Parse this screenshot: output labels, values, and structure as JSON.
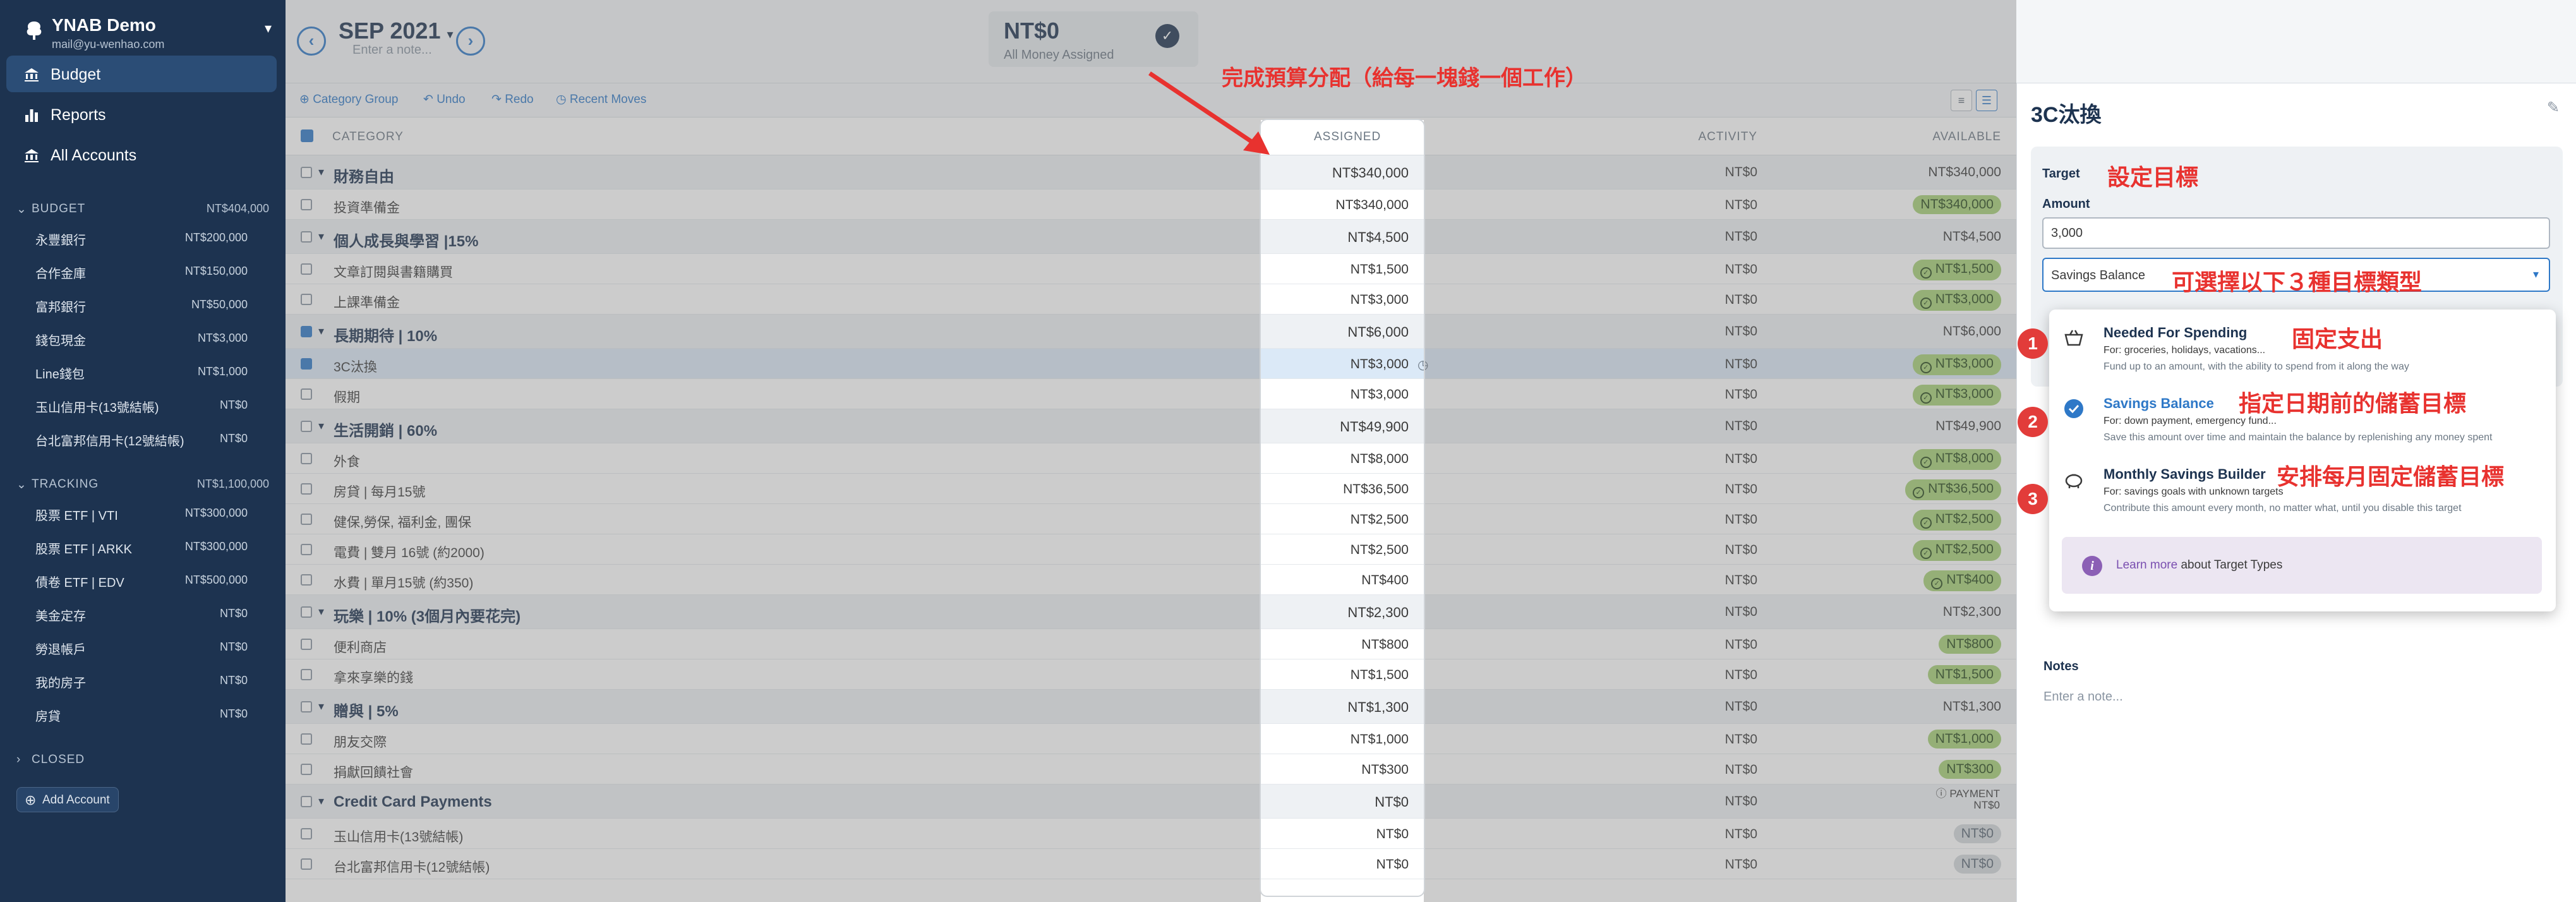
{
  "sidebar": {
    "budget_name": "YNAB Demo",
    "email": "mail@yu-wenhao.com",
    "nav": [
      {
        "label": "Budget",
        "icon": "bank-icon"
      },
      {
        "label": "Reports",
        "icon": "bar-chart-icon"
      },
      {
        "label": "All Accounts",
        "icon": "bank-icon"
      }
    ],
    "budget_section": {
      "title": "BUDGET",
      "amount": "NT$404,000"
    },
    "budget_accounts": [
      {
        "name": "永豐銀行",
        "value": "NT$200,000"
      },
      {
        "name": "合作金庫",
        "value": "NT$150,000"
      },
      {
        "name": "富邦銀行",
        "value": "NT$50,000"
      },
      {
        "name": "錢包現金",
        "value": "NT$3,000"
      },
      {
        "name": "Line錢包",
        "value": "NT$1,000"
      },
      {
        "name": "玉山信用卡(13號結帳)",
        "value": "NT$0"
      },
      {
        "name": "台北富邦信用卡(12號結帳)",
        "value": "NT$0"
      }
    ],
    "tracking_section": {
      "title": "TRACKING",
      "amount": "NT$1,100,000"
    },
    "tracking_accounts": [
      {
        "name": "股票 ETF | VTI",
        "value": "NT$300,000"
      },
      {
        "name": "股票 ETF | ARKK",
        "value": "NT$300,000"
      },
      {
        "name": "債卷 ETF | EDV",
        "value": "NT$500,000"
      },
      {
        "name": "美金定存",
        "value": "NT$0"
      },
      {
        "name": "勞退帳戶",
        "value": "NT$0"
      },
      {
        "name": "我的房子",
        "value": "NT$0"
      },
      {
        "name": "房貸",
        "value": "NT$0"
      }
    ],
    "closed_label": "CLOSED",
    "add_account": "Add Account"
  },
  "header": {
    "month": "SEP 2021",
    "month_caret": "▾",
    "note_placeholder": "Enter a note...",
    "prev": "‹",
    "next": "›",
    "tbb_value": "NT$0",
    "tbb_label": "All Money Assigned"
  },
  "toolbar": {
    "category_group": "Category Group",
    "undo": "Undo",
    "redo": "Redo",
    "recent_moves": "Recent Moves"
  },
  "columns": {
    "category": "CATEGORY",
    "assigned": "ASSIGNED",
    "activity": "ACTIVITY",
    "available": "AVAILABLE"
  },
  "rows": [
    {
      "type": "group",
      "name": "財務自由",
      "assigned": "NT$340,000",
      "activity": "NT$0",
      "available": "NT$340,000",
      "pill": "none"
    },
    {
      "type": "cat",
      "name": "投資準備金",
      "assigned": "NT$340,000",
      "activity": "NT$0",
      "available": "NT$340,000",
      "pill": "green"
    },
    {
      "type": "group",
      "name": "個人成長與學習 |15%",
      "assigned": "NT$4,500",
      "activity": "NT$0",
      "available": "NT$4,500",
      "pill": "none"
    },
    {
      "type": "cat",
      "name": "文章訂閱與書籍購買",
      "assigned": "NT$1,500",
      "activity": "NT$0",
      "available": "NT$1,500",
      "pill": "green-dot"
    },
    {
      "type": "cat",
      "name": "上課準備金",
      "assigned": "NT$3,000",
      "activity": "NT$0",
      "available": "NT$3,000",
      "pill": "green-dot"
    },
    {
      "type": "group",
      "name": "長期期待 | 10%",
      "assigned": "NT$6,000",
      "activity": "NT$0",
      "available": "NT$6,000",
      "pill": "none",
      "checked": true
    },
    {
      "type": "cat",
      "name": "3C汰換",
      "assigned": "NT$3,000",
      "activity": "NT$0",
      "available": "NT$3,000",
      "pill": "green-dot",
      "selected": true
    },
    {
      "type": "cat",
      "name": "假期",
      "assigned": "NT$3,000",
      "activity": "NT$0",
      "available": "NT$3,000",
      "pill": "green-dot"
    },
    {
      "type": "group",
      "name": "生活開銷 | 60%",
      "assigned": "NT$49,900",
      "activity": "NT$0",
      "available": "NT$49,900",
      "pill": "none"
    },
    {
      "type": "cat",
      "name": "外食",
      "assigned": "NT$8,000",
      "activity": "NT$0",
      "available": "NT$8,000",
      "pill": "green-dot"
    },
    {
      "type": "cat",
      "name": "房貸 | 每月15號",
      "assigned": "NT$36,500",
      "activity": "NT$0",
      "available": "NT$36,500",
      "pill": "green-dot"
    },
    {
      "type": "cat",
      "name": "健保,勞保, 福利金, 團保",
      "assigned": "NT$2,500",
      "activity": "NT$0",
      "available": "NT$2,500",
      "pill": "green-dot"
    },
    {
      "type": "cat",
      "name": "電費 | 雙月 16號 (約2000)",
      "assigned": "NT$2,500",
      "activity": "NT$0",
      "available": "NT$2,500",
      "pill": "green-dot"
    },
    {
      "type": "cat",
      "name": "水費 | 單月15號 (約350)",
      "assigned": "NT$400",
      "activity": "NT$0",
      "available": "NT$400",
      "pill": "green-dot"
    },
    {
      "type": "group",
      "name": "玩樂 | 10% (3個月內要花完)",
      "assigned": "NT$2,300",
      "activity": "NT$0",
      "available": "NT$2,300",
      "pill": "none"
    },
    {
      "type": "cat",
      "name": "便利商店",
      "assigned": "NT$800",
      "activity": "NT$0",
      "available": "NT$800",
      "pill": "green"
    },
    {
      "type": "cat",
      "name": "拿來享樂的錢",
      "assigned": "NT$1,500",
      "activity": "NT$0",
      "available": "NT$1,500",
      "pill": "green"
    },
    {
      "type": "group",
      "name": "贈與 | 5%",
      "assigned": "NT$1,300",
      "activity": "NT$0",
      "available": "NT$1,300",
      "pill": "none"
    },
    {
      "type": "cat",
      "name": "朋友交際",
      "assigned": "NT$1,000",
      "activity": "NT$0",
      "available": "NT$1,000",
      "pill": "green"
    },
    {
      "type": "cat",
      "name": "捐獻回饋社會",
      "assigned": "NT$300",
      "activity": "NT$0",
      "available": "NT$300",
      "pill": "green"
    },
    {
      "type": "group",
      "name": "Credit Card Payments",
      "assigned": "NT$0",
      "activity": "NT$0",
      "available": "NT$0",
      "pill": "payment",
      "payment_label": "PAYMENT"
    },
    {
      "type": "cat",
      "name": "玉山信用卡(13號結帳)",
      "assigned": "NT$0",
      "activity": "NT$0",
      "available": "NT$0",
      "pill": "gray"
    },
    {
      "type": "cat",
      "name": "台北富邦信用卡(12號結帳)",
      "assigned": "NT$0",
      "activity": "NT$0",
      "available": "NT$0",
      "pill": "gray"
    }
  ],
  "inspector": {
    "title": "3C汰換",
    "target_label": "Target",
    "amount_label": "Amount",
    "amount_value": "3,000",
    "select_value": "Savings Balance",
    "options": [
      {
        "title": "Needed For Spending",
        "for": "For: groceries, holidays, vacations...",
        "desc": "Fund up to an amount, with the ability to spend from it along the way",
        "icon": "basket-icon",
        "selected": false
      },
      {
        "title": "Savings Balance",
        "for": "For: down payment, emergency fund...",
        "desc": "Save this amount over time and maintain the balance by replenishing any money spent",
        "icon": "check-circle-icon",
        "selected": true
      },
      {
        "title": "Monthly Savings Builder",
        "for": "For: savings goals with unknown targets",
        "desc": "Contribute this amount every month, no matter what, until you disable this target",
        "icon": "piggy-bank-icon",
        "selected": false
      }
    ],
    "learn_link": "Learn more",
    "learn_rest": " about Target Types",
    "notes_label": "Notes",
    "notes_placeholder": "Enter a note..."
  },
  "annotations": {
    "assign_hint": "完成預算分配（給每一塊錢一個工作）",
    "set_target": "設定目標",
    "choose_type": "可選擇以下３種目標類型",
    "fixed_spend": "固定支出",
    "savings_by_date": "指定日期前的儲蓄目標",
    "monthly_fixed": "安排每月固定儲蓄目標",
    "badges": [
      "1",
      "2",
      "3"
    ]
  },
  "colors": {
    "sidebar": "#1d3350",
    "accent": "#2e78c7",
    "annotation": "#e8322f",
    "funded": "#a6d176"
  }
}
